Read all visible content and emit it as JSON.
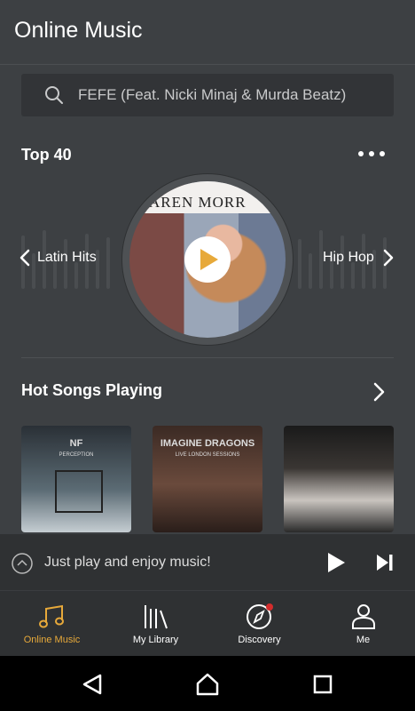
{
  "header": {
    "title": "Online Music"
  },
  "search": {
    "query": "FEFE (Feat. Nicki Minaj & Murda Beatz)",
    "icon": "search-icon"
  },
  "top40": {
    "title": "Top 40",
    "prev_label": "Latin Hits",
    "next_label": "Hip Hop",
    "cover_artist": "AREN MORR"
  },
  "hot": {
    "title": "Hot Songs Playing",
    "cards": [
      {
        "title": "NF",
        "subtitle": "PERCEPTION"
      },
      {
        "title": "IMAGINE DRAGONS",
        "subtitle": "LIVE LONDON SESSIONS"
      },
      {
        "title": "",
        "subtitle": ""
      }
    ]
  },
  "player": {
    "message": "Just play and enjoy music!"
  },
  "tabs": [
    {
      "label": "Online Music",
      "icon": "music-note-icon",
      "active": true
    },
    {
      "label": "My Library",
      "icon": "library-icon"
    },
    {
      "label": "Discovery",
      "icon": "compass-icon",
      "badge": true
    },
    {
      "label": "Me",
      "icon": "person-icon"
    }
  ],
  "colors": {
    "accent": "#e7a93a",
    "badge": "#d42c2c",
    "background": "#3d4043",
    "bar": "#2f3133"
  }
}
